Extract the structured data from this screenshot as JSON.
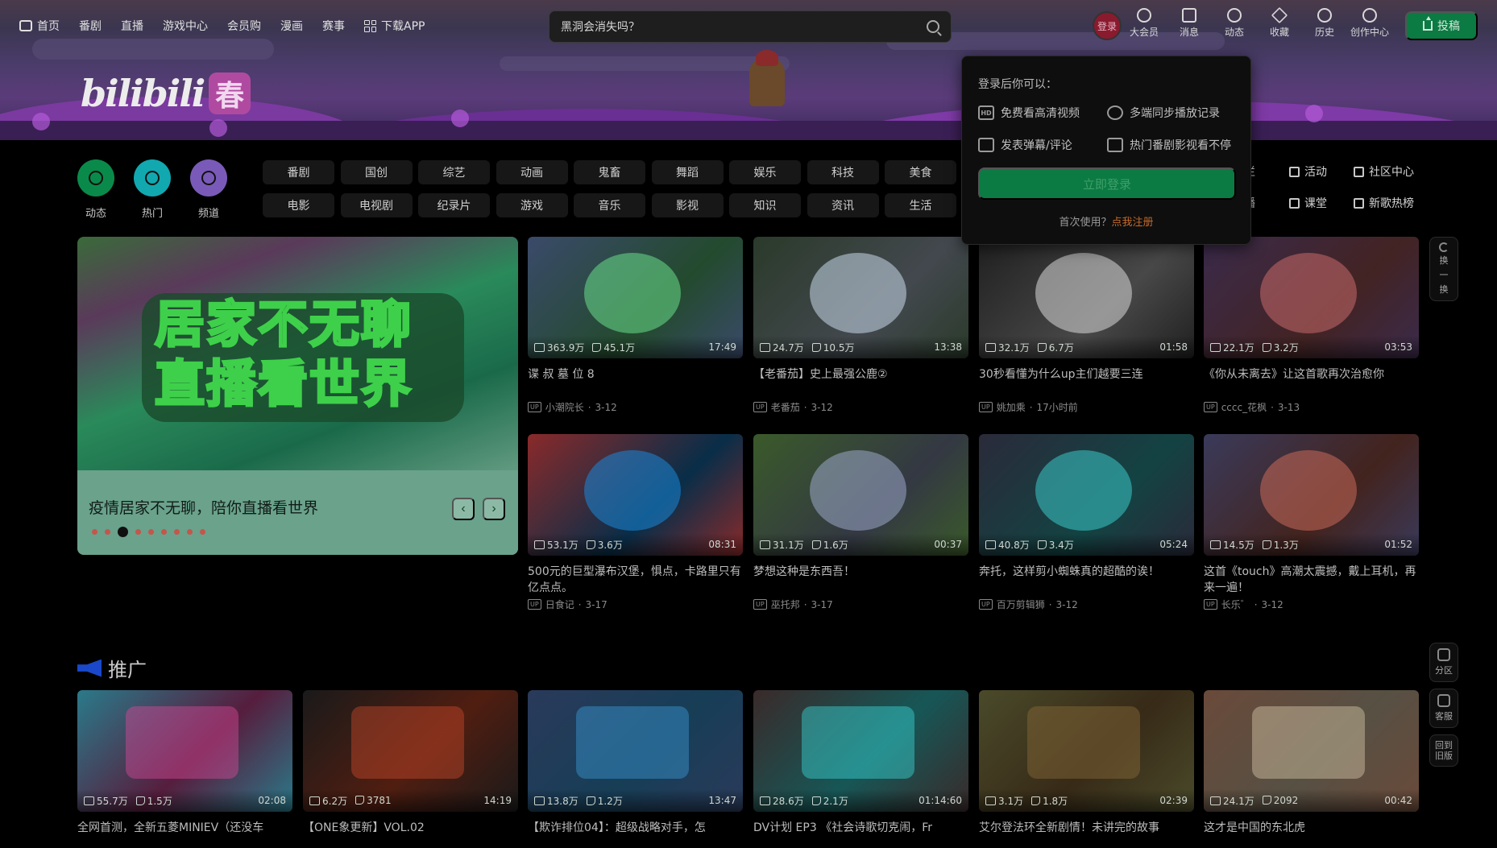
{
  "nav": {
    "left": [
      {
        "label": "首页",
        "icon": "tv-icon"
      },
      {
        "label": "番剧"
      },
      {
        "label": "直播"
      },
      {
        "label": "游戏中心"
      },
      {
        "label": "会员购"
      },
      {
        "label": "漫画"
      },
      {
        "label": "赛事"
      },
      {
        "label": "下载APP",
        "icon": "app-grid-icon"
      }
    ],
    "search_placeholder": "黑洞会消失吗？",
    "login_avatar": "登录",
    "right": [
      {
        "label": "大会员",
        "icon": "vip-icon"
      },
      {
        "label": "消息",
        "icon": "message-icon"
      },
      {
        "label": "动态",
        "icon": "dynamic-icon"
      },
      {
        "label": "收藏",
        "icon": "star-icon"
      },
      {
        "label": "历史",
        "icon": "history-icon"
      },
      {
        "label": "创作中心",
        "icon": "creator-icon"
      }
    ],
    "upload": "投稿"
  },
  "banner": {
    "logo_text": "bilibili",
    "logo_badge": "春"
  },
  "quick": [
    {
      "label": "动态",
      "color": "#0a8a4a"
    },
    {
      "label": "热门",
      "color": "#12a8b0"
    },
    {
      "label": "频道",
      "color": "#7a5ab8"
    }
  ],
  "chips": [
    "番剧",
    "国创",
    "综艺",
    "动画",
    "鬼畜",
    "舞蹈",
    "娱乐",
    "科技",
    "美食",
    "电影",
    "电视剧",
    "纪录片",
    "游戏",
    "音乐",
    "影视",
    "知识",
    "资讯",
    "生活"
  ],
  "links_right": [
    {
      "label": "专栏"
    },
    {
      "label": "活动"
    },
    {
      "label": "社区中心"
    },
    {
      "label": "直播"
    },
    {
      "label": "课堂"
    },
    {
      "label": "新歌热榜"
    }
  ],
  "carousel": {
    "headline_1": "居家不无聊",
    "headline_2": "直播看世界",
    "caption": "疫情居家不无聊，陪你直播看世界",
    "prev": "‹",
    "next": "›",
    "dots": 9,
    "active": 2
  },
  "videos": [
    {
      "views": "363.9万",
      "likes": "45.1万",
      "duration": "17:49",
      "title": "谍 叔 墓 位 8",
      "up": "小潮院长",
      "date": "3-12",
      "bg": "#3a4a6a",
      "accent": "#6adf8a"
    },
    {
      "views": "24.7万",
      "likes": "10.5万",
      "duration": "13:38",
      "title": "【老番茄】史上最强公鹿②",
      "up": "老番茄",
      "date": "3-12",
      "bg": "#2a3a2a",
      "accent": "#c8d8ea"
    },
    {
      "views": "32.1万",
      "likes": "6.7万",
      "duration": "01:58",
      "title": "30秒看懂为什么up主们越要三连",
      "up": "姚加乘",
      "date": "17小时前",
      "bg": "#202020",
      "accent": "#d8d8d8"
    },
    {
      "views": "22.1万",
      "likes": "3.2万",
      "duration": "03:53",
      "title": "《你从未离去》让这首歌再次治愈你",
      "up": "cccc_花枫",
      "date": "3-13",
      "bg": "#3a2a4a",
      "accent": "#c86a6a"
    },
    {
      "views": "53.1万",
      "likes": "3.6万",
      "duration": "08:31",
      "title": "500元的巨型瀑布汉堡，惧点，卡路里只有亿点点。",
      "up": "日食记",
      "date": "3-17",
      "bg": "#8a2a2a",
      "accent": "#1a88d8"
    },
    {
      "views": "31.1万",
      "likes": "1.6万",
      "duration": "00:37",
      "title": "梦想这种是东西吾！",
      "up": "巫托邦",
      "date": "3-17",
      "bg": "#3a5a2a",
      "accent": "#9aa8c8"
    },
    {
      "views": "40.8万",
      "likes": "3.4万",
      "duration": "05:24",
      "title": "奔托，这样剪小蜘蛛真的超酷的诶！",
      "up": "百万剪辑狮",
      "date": "3-12",
      "bg": "#2a2a3a",
      "accent": "#3ac8c8"
    },
    {
      "views": "14.5万",
      "likes": "1.3万",
      "duration": "01:52",
      "title": "这首《touch》高潮太震撼，戴上耳机，再来一遍！",
      "up": "长乐゛",
      "date": "3-12",
      "bg": "#3a3a5a",
      "accent": "#c86a5a"
    }
  ],
  "popover": {
    "title": "登录后你可以：",
    "features": [
      {
        "label": "免费看高清视频",
        "icon": "hd-icon",
        "icon_text": "HD"
      },
      {
        "label": "多端同步播放记录",
        "icon": "clock-icon"
      },
      {
        "label": "发表弹幕/评论",
        "icon": "danmaku-icon"
      },
      {
        "label": "热门番剧影视看不停",
        "icon": "tv-play-icon"
      }
    ],
    "login_button": "立即登录",
    "first_use": "首次使用？",
    "register": "点我注册"
  },
  "side": {
    "refresh": [
      "换",
      "一",
      "换"
    ],
    "zone": "分区",
    "service": "客服",
    "old_version": "回到旧版"
  },
  "promo": {
    "title": "推广",
    "items": [
      {
        "views": "55.7万",
        "likes": "1.5万",
        "duration": "02:08",
        "title": "全网首测，全新五菱MINIEV（还没车"
      },
      {
        "views": "6.2万",
        "likes": "3781",
        "duration": "14:19",
        "title": "【ONE象更新】VOL.02"
      },
      {
        "views": "13.8万",
        "likes": "1.2万",
        "duration": "13:47",
        "title": "【欺诈排位04】：超级战略对手，怎"
      },
      {
        "views": "28.6万",
        "likes": "2.1万",
        "duration": "01:14:60",
        "title": "DV计划 EP3 《社会诗歌切克闹，Fr"
      },
      {
        "views": "3.1万",
        "likes": "1.8万",
        "duration": "02:39",
        "title": "艾尔登法环全新剧情！未讲完的故事"
      },
      {
        "views": "24.1万",
        "likes": "2092",
        "duration": "00:42",
        "title": "这才是中国的东北虎"
      }
    ]
  }
}
